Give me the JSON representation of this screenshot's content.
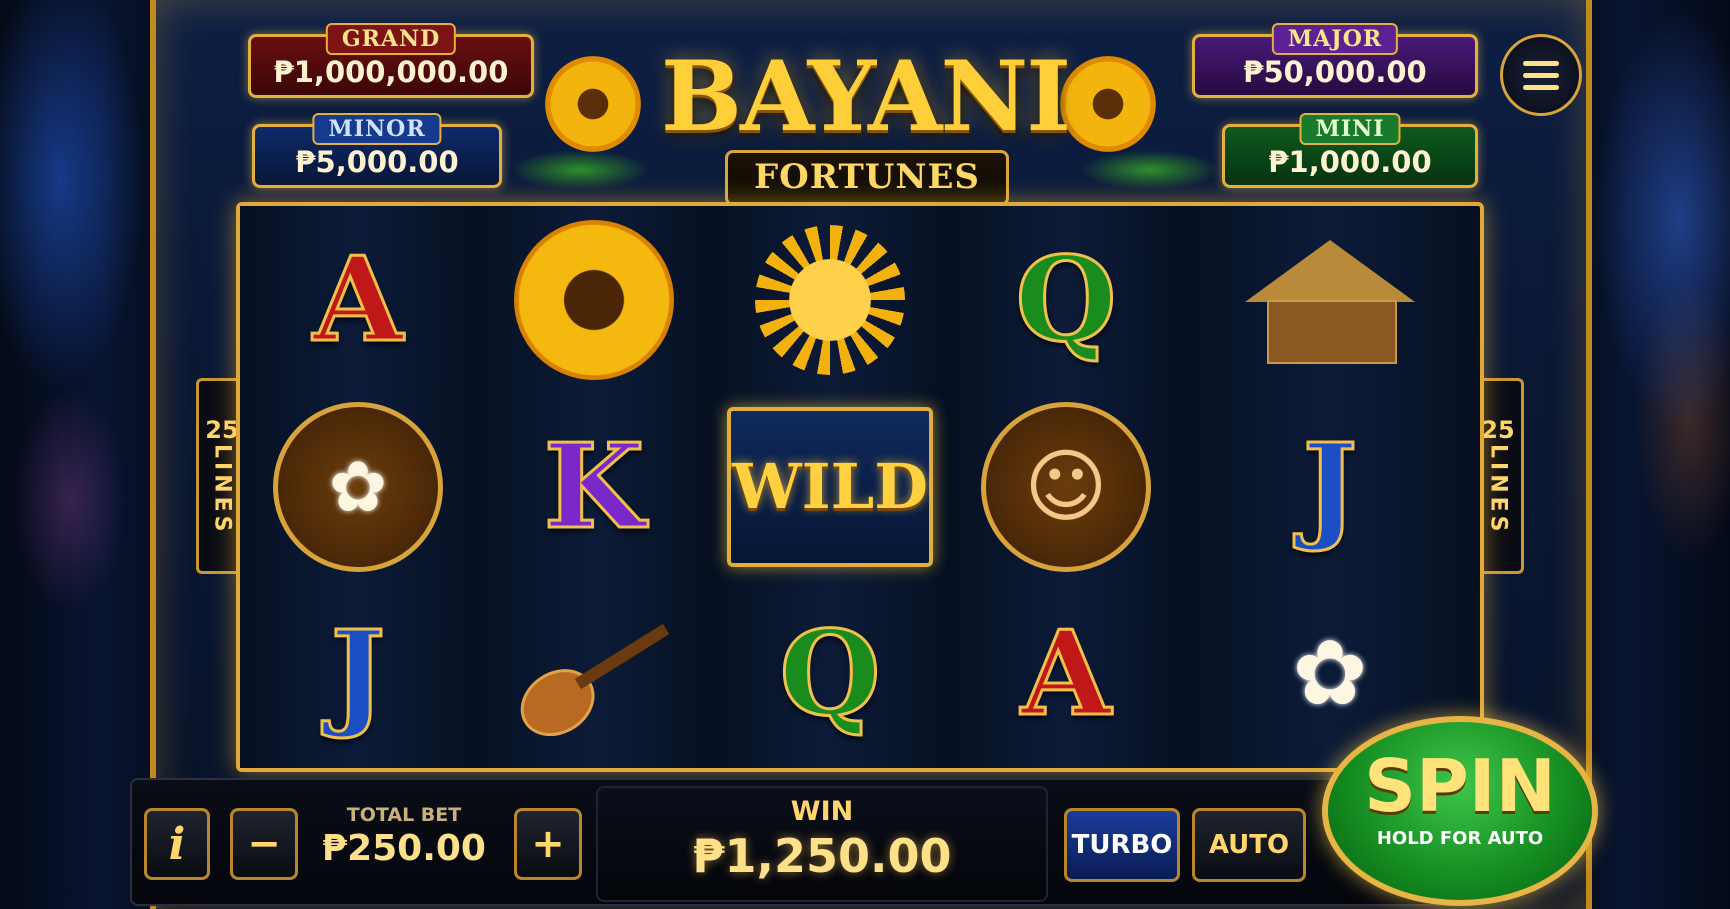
{
  "jackpots": {
    "grand": {
      "label": "GRAND",
      "amount": "₱1,000,000.00"
    },
    "major": {
      "label": "MAJOR",
      "amount": "₱50,000.00"
    },
    "minor": {
      "label": "MINOR",
      "amount": "₱5,000.00"
    },
    "mini": {
      "label": "MINI",
      "amount": "₱1,000.00"
    }
  },
  "logo": {
    "title": "BAYANI",
    "subtitle": "FORTUNES"
  },
  "paylines": {
    "count": "25",
    "label": "LINES"
  },
  "reels": [
    [
      "A",
      "flower-cluster",
      "J"
    ],
    [
      "sunflower",
      "K",
      "guitar"
    ],
    [
      "sun",
      "WILD",
      "Q"
    ],
    [
      "Q",
      "woman",
      "A"
    ],
    [
      "hut",
      "J",
      "flower-cluster"
    ]
  ],
  "controls": {
    "info_label": "i",
    "minus_label": "−",
    "plus_label": "+",
    "total_bet_label": "TOTAL BET",
    "total_bet_value": "₱250.00",
    "win_label": "WIN",
    "win_value": "₱1,250.00",
    "turbo_label": "TURBO",
    "auto_label": "AUTO",
    "spin_label": "SPIN",
    "spin_sub_label": "HOLD FOR AUTO"
  },
  "colors": {
    "gold": "#e1a938",
    "spin_green": "#138a1f",
    "turbo_blue": "#1a3c9c"
  }
}
